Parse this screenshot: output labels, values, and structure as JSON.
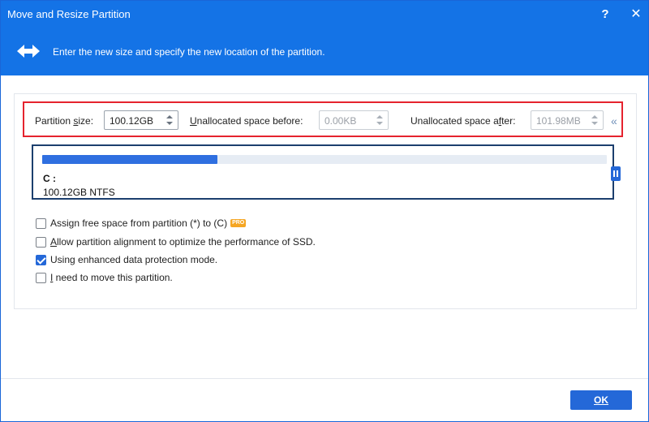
{
  "window": {
    "title": "Move and Resize Partition",
    "help_label": "?",
    "close_label": "✕"
  },
  "header": {
    "instruction": "Enter the new size and specify the new location of the partition.",
    "icon": "double-arrow-icon"
  },
  "fields": {
    "partition_size": {
      "label_pre": "Partition ",
      "label_ul": "s",
      "label_post": "ize:",
      "value": "100.12GB"
    },
    "unallocated_before": {
      "label_ul": "U",
      "label_post": "nallocated space before:",
      "value": "0.00KB"
    },
    "unallocated_after": {
      "label_pre": "Unallocated space a",
      "label_ul": "f",
      "label_post": "ter:",
      "value": "101.98MB"
    },
    "collapse_label": "«"
  },
  "partition": {
    "drive": "C :",
    "info": "100.12GB NTFS",
    "used_fraction": 0.31
  },
  "options": [
    {
      "pre": "",
      "ul": "",
      "post": "Assign free space from partition (*) to (C)",
      "checked": false,
      "badge": "PRO"
    },
    {
      "pre": "",
      "ul": "A",
      "post": "llow partition alignment to optimize the performance of SSD.",
      "checked": false
    },
    {
      "pre": "",
      "ul": "",
      "post": "Using enhanced data protection mode.",
      "checked": true
    },
    {
      "pre": "",
      "ul": "I",
      "post": " need to move this partition.",
      "checked": false
    }
  ],
  "footer": {
    "ok_label": "OK"
  },
  "colors": {
    "accent": "#1473e6",
    "highlight_border": "#e5232e",
    "bar_fill": "#2f6fe0",
    "badge": "#f5a623"
  }
}
